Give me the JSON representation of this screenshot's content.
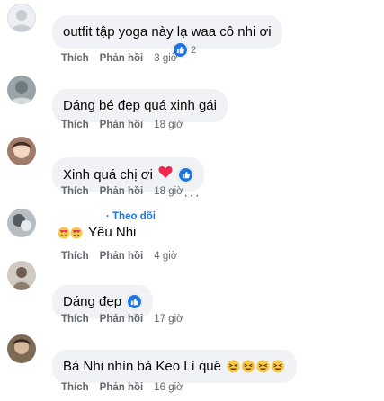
{
  "actions": {
    "like": "Thích",
    "reply": "Phản hồi"
  },
  "comments": [
    {
      "text": "outfit tập yoga này lạ waa cô nhi ơi",
      "time": "3 giờ",
      "reaction_count": "2"
    },
    {
      "text": "Dáng bé đẹp quá xinh gái",
      "time": "18 giờ"
    },
    {
      "text": "Xinh quá chị ơi",
      "time": "18 giờ"
    },
    {
      "text": "Yêu Nhi",
      "time": "4 giờ",
      "follow": "Theo dõi",
      "more": "···"
    },
    {
      "text": "Dáng đẹp",
      "time": "17 giờ"
    },
    {
      "text": "Bà Nhi nhìn bả Keo Lì quê",
      "time": "16 giờ"
    }
  ],
  "colors": {
    "accent": "#1b74e4",
    "bubble": "#f0f2f5",
    "meta": "#65676b",
    "heart": "#f02849"
  }
}
